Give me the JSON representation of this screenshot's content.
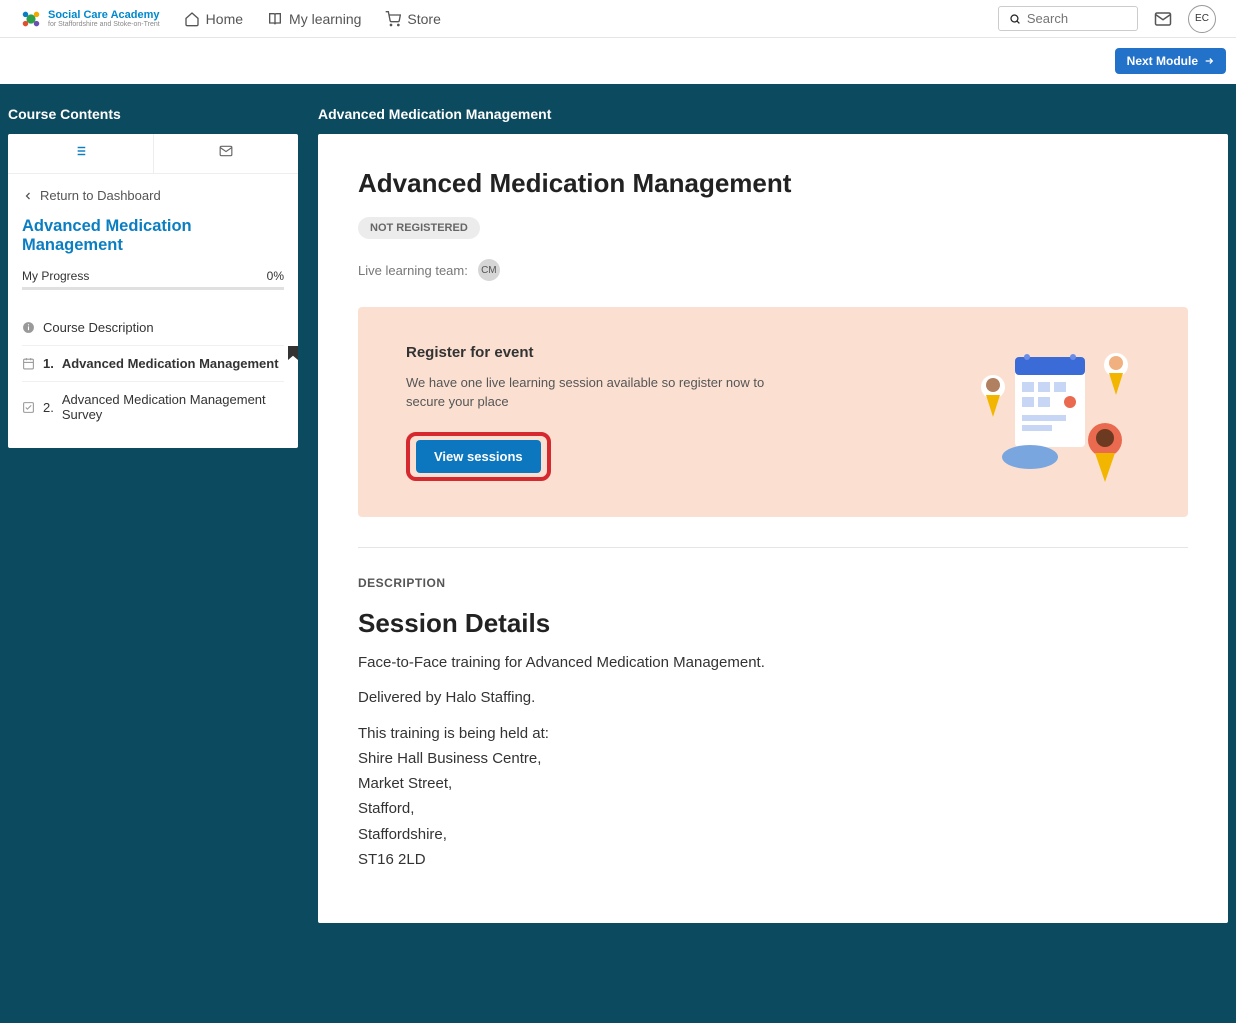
{
  "header": {
    "logo_main": "Social Care Academy",
    "logo_sub": "for Staffordshire and Stoke-on-Trent",
    "nav_home": "Home",
    "nav_learning": "My learning",
    "nav_store": "Store",
    "search_placeholder": "Search",
    "avatar_initials": "EC"
  },
  "subheader": {
    "next_module": "Next Module"
  },
  "sidebar": {
    "title": "Course Contents",
    "return_label": "Return to Dashboard",
    "course_name": "Advanced Medication Management",
    "progress_label": "My Progress",
    "progress_value": "0%",
    "items": [
      {
        "icon": "info",
        "num": "",
        "label": "Course Description"
      },
      {
        "icon": "calendar",
        "num": "1.",
        "label": "Advanced Medication Management"
      },
      {
        "icon": "check",
        "num": "2.",
        "label": "Advanced Medication Management Survey"
      }
    ]
  },
  "content": {
    "breadcrumb": "Advanced Medication Management",
    "page_title": "Advanced Medication Management",
    "status": "NOT REGISTERED",
    "team_label": "Live learning team:",
    "team_initials": "CM",
    "register": {
      "title": "Register for event",
      "text": "We have one live learning session available so register now to secure your place",
      "button": "View sessions"
    },
    "description_label": "DESCRIPTION",
    "session_title": "Session Details",
    "session_intro": "Face-to-Face training for Advanced Medication Management.",
    "session_delivered": "Delivered by Halo Staffing.",
    "session_location_intro": "This training is being held at:",
    "address": [
      "Shire Hall Business Centre,",
      "Market Street,",
      "Stafford,",
      "Staffordshire,",
      "ST16 2LD"
    ]
  }
}
